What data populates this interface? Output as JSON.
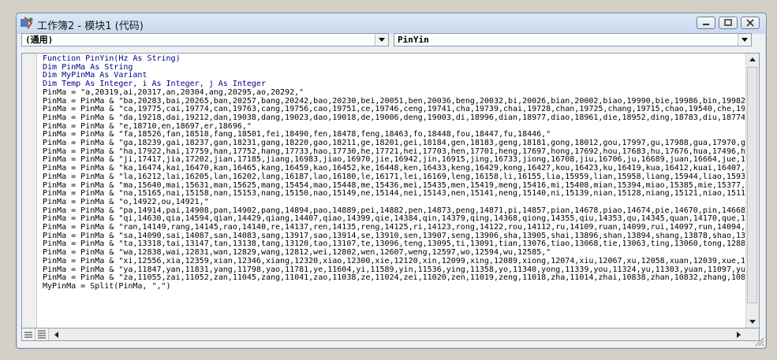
{
  "window": {
    "title": "工作簿2 - 模块1 (代码)"
  },
  "combos": {
    "object_value": "(通用)",
    "procedure_value": "PinYin"
  },
  "code_lines": [
    "Function PinYin(Hz As String)",
    "Dim PinMa As String",
    "Dim MyPinMa As Variant",
    "Dim Temp As Integer, i As Integer, j As Integer",
    "PinMa = \"a,20319,ai,20317,an,20304,ang,20295,ao,20292,\"",
    "PinMa = PinMa & \"ba,20283,bai,20265,ban,20257,bang,20242,bao,20230,bei,20051,ben,20036,beng,20032,bi,20026,bian,20002,biao,19990,bie,19986,bin,19982,",
    "PinMa = PinMa & \"ca,19775,cai,19774,can,19763,cang,19756,cao,19751,ce,19746,ceng,19741,cha,19739,chai,19728,chan,19725,chang,19715,chao,19540,che,195",
    "PinMa = PinMa & \"da,19218,dai,19212,dan,19038,dang,19023,dao,19018,de,19006,deng,19003,di,18996,dian,18977,diao,18961,die,18952,ding,18783,diu,18774,",
    "PinMa = PinMa & \"e,18710,en,18697,er,18696,\"",
    "PinMa = PinMa & \"fa,18526,fan,18518,fang,18501,fei,18490,fen,18478,feng,18463,fo,18448,fou,18447,fu,18446,\"",
    "PinMa = PinMa & \"ga,18239,gai,18237,gan,18231,gang,18220,gao,18211,ge,18201,gei,18184,gen,18183,geng,18181,gong,18012,gou,17997,gu,17988,gua,17970,g",
    "PinMa = PinMa & \"ha,17922,hai,17759,han,17752,hang,17733,hao,17730,he,17721,hei,17703,hen,17701,heng,17697,hong,17692,hou,17683,hu,17676,hua,17496,hu",
    "PinMa = PinMa & \"ji,17417,jia,17202,jian,17185,jiang,16983,jiao,16970,jie,16942,jin,16915,jing,16733,jiong,16708,jiu,16706,ju,16689,juan,16664,jue,1",
    "PinMa = PinMa & \"ka,16474,kai,16470,kan,16465,kang,16459,kao,16452,ke,16448,ken,16433,keng,16429,kong,16427,kou,16423,ku,16419,kua,16412,kuai,16407,k",
    "PinMa = PinMa & \"la,16212,lai,16205,lan,16202,lang,16187,lao,16180,le,16171,lei,16169,leng,16158,li,16155,lia,15959,lian,15958,liang,15944,liao,1593",
    "PinMa = PinMa & \"ma,15640,mai,15631,man,15625,mang,15454,mao,15448,me,15436,mei,15435,men,15419,meng,15416,mi,15408,mian,15394,miao,15385,mie,15377,m",
    "PinMa = PinMa & \"na,15165,nai,15158,nan,15153,nang,15150,nao,15149,ne,15144,nei,15143,nen,15141,neng,15140,ni,15139,nian,15128,niang,15121,niao,1511",
    "PinMa = PinMa & \"o,14922,ou,14921,\"",
    "PinMa = PinMa & \"pa,14914,pai,14908,pan,14902,pang,14894,pao,14889,pei,14882,pen,14873,peng,14871,pi,14857,pian,14678,piao,14674,pie,14670,pin,14668,",
    "PinMa = PinMa & \"qi,14630,qia,14594,qian,14429,qiang,14407,qiao,14399,qie,14384,qin,14379,qing,14368,qiong,14355,qiu,14353,qu,14345,quan,14170,que,14",
    "PinMa = PinMa & \"ran,14149,rang,14145,rao,14140,re,14137,ren,14135,reng,14125,ri,14123,rong,14122,rou,14112,ru,14109,ruan,14099,rui,14097,run,14094,r",
    "PinMa = PinMa & \"sa,14090,sai,14087,san,14083,sang,13917,sao,13914,se,13910,sen,13907,seng,13906,sha,13905,shai,13896,shan,13894,shang,13878,shao,138",
    "PinMa = PinMa & \"ta,13318,tai,13147,tan,13138,tang,13120,tao,13107,te,13096,teng,13095,ti,13091,tian,13076,tiao,13068,tie,13063,ting,13060,tong,1288",
    "PinMa = PinMa & \"wa,12838,wai,12831,wan,12829,wang,12812,wei,12802,wen,12607,weng,12597,wo,12594,wu,12585,\"",
    "PinMa = PinMa & \"xi,12556,xia,12359,xian,12346,xiang,12320,xiao,12300,xie,12120,xin,12099,xing,12089,xiong,12074,xiu,12067,xu,12058,xuan,12039,xue,11",
    "PinMa = PinMa & \"ya,11847,yan,11831,yang,11798,yao,11781,ye,11604,yi,11589,yin,11536,ying,11358,yo,11340,yong,11339,you,11324,yu,11303,yuan,11097,yu",
    "PinMa = PinMa & \"za,11055,zai,11052,zan,11045,zang,11041,zao,11038,ze,11024,zei,11020,zen,11019,zeng,11018,zha,11014,zhai,10838,zhan,10832,zhang,1081",
    "MyPinMa = Split(PinMa, \",\")"
  ],
  "colors": {
    "keyword": "#00008b",
    "text": "#000000"
  }
}
